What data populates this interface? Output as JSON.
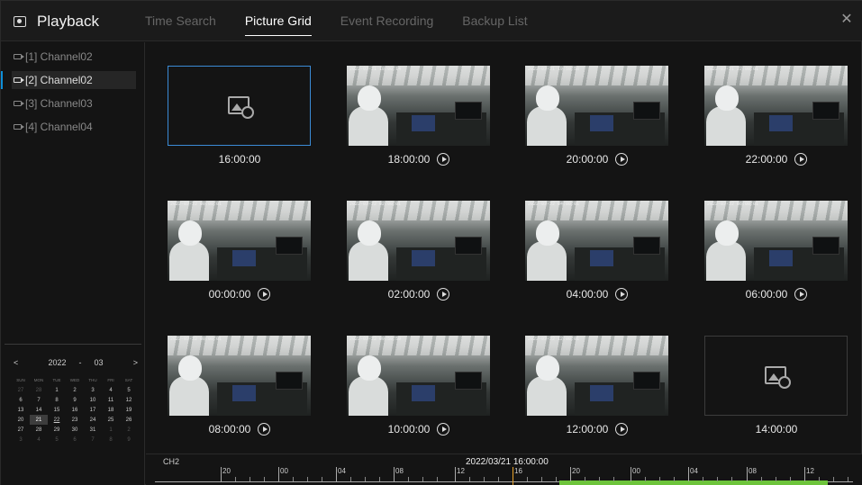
{
  "header": {
    "title": "Playback",
    "tabs": [
      {
        "label": "Time Search",
        "active": false
      },
      {
        "label": "Picture Grid",
        "active": true
      },
      {
        "label": "Event Recording",
        "active": false
      },
      {
        "label": "Backup List",
        "active": false
      }
    ],
    "close_icon": "close-icon"
  },
  "sidebar": {
    "channels": [
      {
        "label": "[1] Channel02",
        "active": false
      },
      {
        "label": "[2] Channel02",
        "active": true
      },
      {
        "label": "[3] Channel03",
        "active": false
      },
      {
        "label": "[4] Channel04",
        "active": false
      }
    ],
    "calendar": {
      "prev": "<",
      "year": "2022",
      "sep": "-",
      "month": "03",
      "next": ">",
      "weekdays": [
        "SUN",
        "MON",
        "TUE",
        "WED",
        "THU",
        "FRI",
        "SAT"
      ],
      "days": [
        {
          "d": "27",
          "dim": true
        },
        {
          "d": "28",
          "dim": true
        },
        {
          "d": "1"
        },
        {
          "d": "2"
        },
        {
          "d": "3"
        },
        {
          "d": "4"
        },
        {
          "d": "5"
        },
        {
          "d": "6"
        },
        {
          "d": "7"
        },
        {
          "d": "8"
        },
        {
          "d": "9"
        },
        {
          "d": "10"
        },
        {
          "d": "11"
        },
        {
          "d": "12"
        },
        {
          "d": "13"
        },
        {
          "d": "14"
        },
        {
          "d": "15"
        },
        {
          "d": "16"
        },
        {
          "d": "17"
        },
        {
          "d": "18"
        },
        {
          "d": "19"
        },
        {
          "d": "20"
        },
        {
          "d": "21",
          "selected": true
        },
        {
          "d": "22",
          "has": true
        },
        {
          "d": "23"
        },
        {
          "d": "24"
        },
        {
          "d": "25"
        },
        {
          "d": "26"
        },
        {
          "d": "27"
        },
        {
          "d": "28"
        },
        {
          "d": "29"
        },
        {
          "d": "30"
        },
        {
          "d": "31"
        },
        {
          "d": "1",
          "dim": true
        },
        {
          "d": "2",
          "dim": true
        },
        {
          "d": "3",
          "dim": true
        },
        {
          "d": "4",
          "dim": true
        },
        {
          "d": "5",
          "dim": true
        },
        {
          "d": "6",
          "dim": true
        },
        {
          "d": "7",
          "dim": true
        },
        {
          "d": "8",
          "dim": true
        },
        {
          "d": "9",
          "dim": true
        }
      ]
    }
  },
  "grid": [
    {
      "time": "16:00:00",
      "has_image": false,
      "selected": true,
      "stamp": ""
    },
    {
      "time": "18:00:00",
      "has_image": true,
      "stamp": "2022-03-21 18:00:14"
    },
    {
      "time": "20:00:00",
      "has_image": true,
      "stamp": "2022-03-21 19:59:58"
    },
    {
      "time": "22:00:00",
      "has_image": true,
      "stamp": "2022-03-21 22:00:01"
    },
    {
      "time": "00:00:00",
      "has_image": true,
      "stamp": "2022-03-22 00:00:01"
    },
    {
      "time": "02:00:00",
      "has_image": true,
      "stamp": "2022-03-22 02:00:01"
    },
    {
      "time": "04:00:00",
      "has_image": true,
      "stamp": "2022-03-22 04:00:01"
    },
    {
      "time": "06:00:00",
      "has_image": true,
      "stamp": "2022-03-22 06:00:01"
    },
    {
      "time": "08:00:00",
      "has_image": true,
      "stamp": "2022-03-22 08:00:01"
    },
    {
      "time": "10:00:00",
      "has_image": true,
      "stamp": "2022-03-22 09:59:59"
    },
    {
      "time": "12:00:00",
      "has_image": true,
      "stamp": "2022-03-22 12:00:01"
    },
    {
      "time": "14:00:00",
      "has_image": false,
      "selected": false,
      "stamp": ""
    }
  ],
  "timeline": {
    "channel": "CH2",
    "current_time": "2022/03/21 16:00:00",
    "ticks": [
      "20",
      "00",
      "04",
      "08",
      "12",
      "16",
      "20",
      "00",
      "04",
      "08",
      "12"
    ],
    "cursor_color": "#e9a22a",
    "record_color": "#6dc43b"
  },
  "colors": {
    "accent": "#0e8fd8",
    "selected_border": "#3b8bd6"
  }
}
